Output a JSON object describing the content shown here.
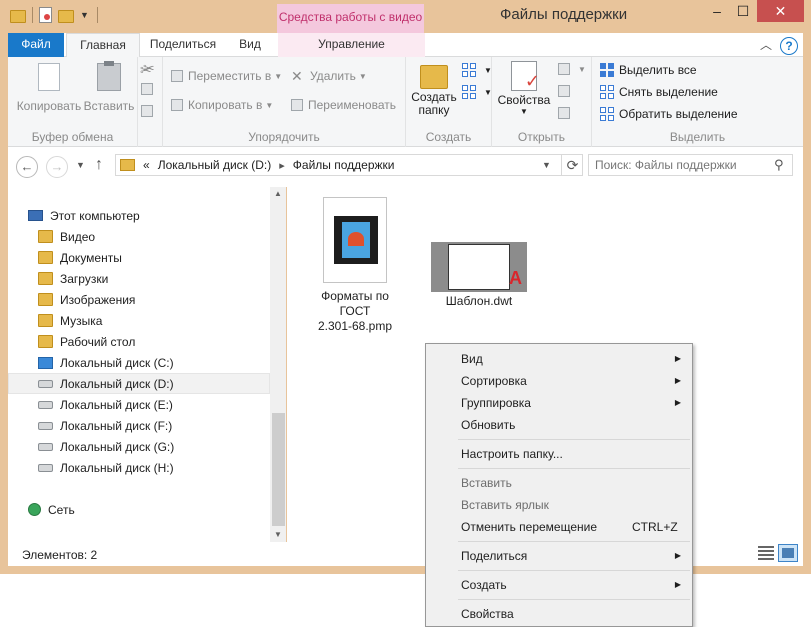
{
  "window": {
    "title": "Файлы поддержки",
    "contextual_tab_header": "Средства работы с видео",
    "buttons": {
      "minimize": "–",
      "maximize": "☐",
      "close": "✕"
    }
  },
  "tabs": [
    {
      "label": "Файл"
    },
    {
      "label": "Главная"
    },
    {
      "label": "Поделиться"
    },
    {
      "label": "Вид"
    },
    {
      "label": "Управление"
    }
  ],
  "ribbon": {
    "clipboard": {
      "label": "Буфер обмена",
      "copy": "Копировать",
      "paste": "Вставить"
    },
    "organize": {
      "label": "Упорядочить",
      "move_to": "Переместить в",
      "copy_to": "Копировать в",
      "delete": "Удалить",
      "rename": "Переименовать"
    },
    "create": {
      "label": "Создать",
      "new_folder_line1": "Создать",
      "new_folder_line2": "папку"
    },
    "open": {
      "label": "Открыть",
      "properties": "Свойства"
    },
    "select": {
      "label": "Выделить",
      "select_all": "Выделить все",
      "select_none": "Снять выделение",
      "invert": "Обратить выделение"
    }
  },
  "navigation": {
    "breadcrumb_prefix": "«",
    "breadcrumb": [
      "Локальный диск (D:)",
      "Файлы поддержки"
    ],
    "search_placeholder": "Поиск: Файлы поддержки"
  },
  "tree": [
    {
      "label": "Этот компьютер",
      "icon": "computer-icon"
    },
    {
      "label": "Видео",
      "icon": "folder-icon"
    },
    {
      "label": "Документы",
      "icon": "folder-icon"
    },
    {
      "label": "Загрузки",
      "icon": "folder-icon"
    },
    {
      "label": "Изображения",
      "icon": "folder-icon"
    },
    {
      "label": "Музыка",
      "icon": "folder-icon"
    },
    {
      "label": "Рабочий стол",
      "icon": "folder-icon"
    },
    {
      "label": "Локальный диск (C:)",
      "icon": "system-drive-icon"
    },
    {
      "label": "Локальный диск (D:)",
      "icon": "drive-icon",
      "selected": true
    },
    {
      "label": "Локальный диск (E:)",
      "icon": "drive-icon"
    },
    {
      "label": "Локальный диск (F:)",
      "icon": "drive-icon"
    },
    {
      "label": "Локальный диск (G:)",
      "icon": "drive-icon"
    },
    {
      "label": "Локальный диск (H:)",
      "icon": "drive-icon"
    },
    {
      "label": "Сеть",
      "icon": "network-icon"
    }
  ],
  "files": [
    {
      "line1": "Форматы по",
      "line2": "ГОСТ",
      "line3": "2.301-68.pmp",
      "icon": "video-file-icon"
    },
    {
      "line1": "Шаблон.dwt",
      "icon": "autocad-file-icon"
    }
  ],
  "status": {
    "items_count": "Элементов: 2"
  },
  "context_menu": {
    "items": [
      {
        "label": "Вид",
        "submenu": true
      },
      {
        "label": "Сортировка",
        "submenu": true
      },
      {
        "label": "Группировка",
        "submenu": true
      },
      {
        "label": "Обновить"
      },
      {
        "label": "Настроить папку..."
      },
      {
        "label": "Вставить",
        "disabled": true
      },
      {
        "label": "Вставить ярлык",
        "disabled": true
      },
      {
        "label": "Отменить перемещение",
        "shortcut": "CTRL+Z"
      },
      {
        "label": "Поделиться",
        "submenu": true
      },
      {
        "label": "Создать",
        "submenu": true
      },
      {
        "label": "Свойства"
      }
    ]
  }
}
